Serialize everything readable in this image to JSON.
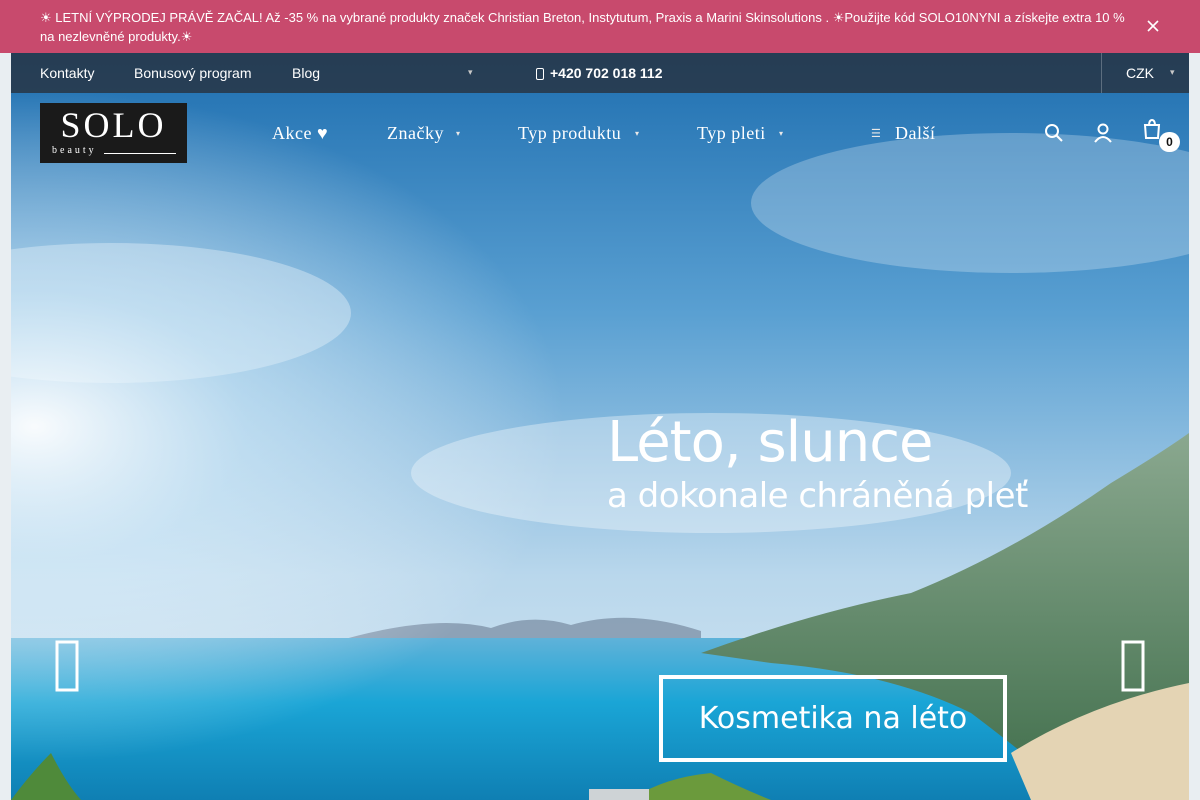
{
  "announcement": {
    "text": "☀ LETNÍ VÝPRODEJ PRÁVĚ ZAČAL! Až -35 % na vybrané produkty značek Christian Breton, Instytutum, Praxis a Marini Skinsolutions . ☀Použijte kód SOLO10NYNI a získejte extra 10 % na nezlevněné produkty.☀"
  },
  "utilbar": {
    "links": [
      "Kontakty",
      "Bonusový program",
      "Blog"
    ],
    "phone": "+420 702 018 112",
    "currency": "CZK"
  },
  "logo": {
    "main": "SOLO",
    "sub": "beauty"
  },
  "nav": {
    "items": [
      "Akce ♥",
      "Značky",
      "Typ produktu",
      "Typ pleti"
    ],
    "more": "Další"
  },
  "cart": {
    "count": "0"
  },
  "hero": {
    "title": "Léto, slunce",
    "subtitle": "a dokonale chráněná pleť",
    "cta": "Kosmetika na léto"
  },
  "colors": {
    "announcement_bg": "#c84a6d",
    "utilbar_bg": "#2a2c30",
    "sea": "#1aa5d6"
  },
  "icons": {
    "close": "close-icon",
    "phone": "phone-icon",
    "search": "search-icon",
    "user": "user-icon",
    "cart": "cart-icon",
    "prev": "chevron-left-icon",
    "next": "chevron-right-icon"
  }
}
